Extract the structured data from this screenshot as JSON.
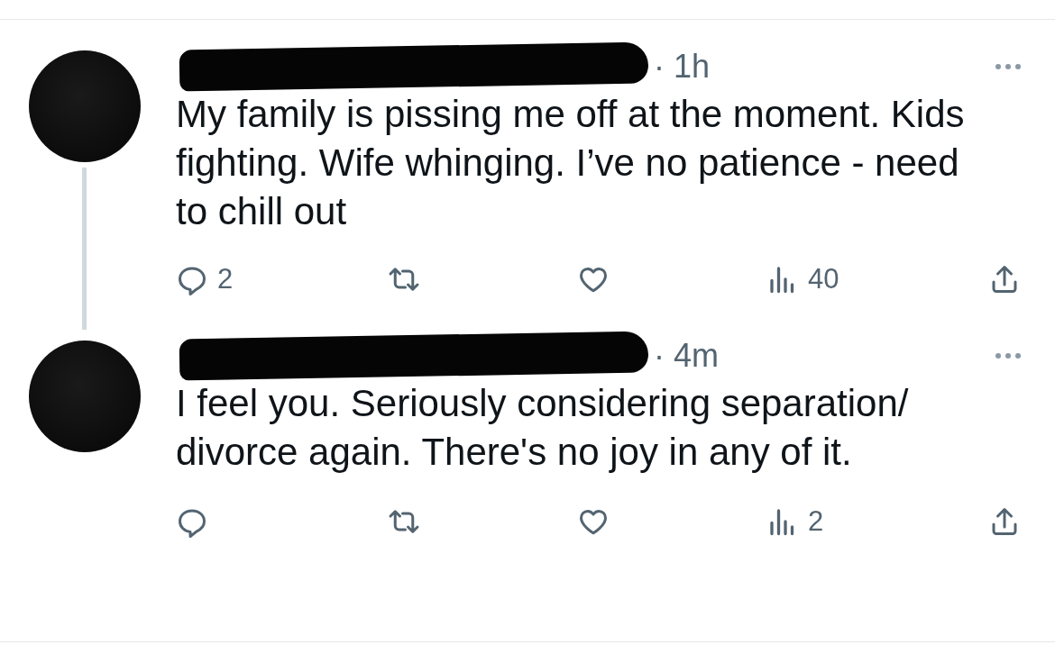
{
  "posts": [
    {
      "time": "· 1h",
      "text": "My family is pissing me off at the moment. Kids fighting. Wife whinging. I’ve no patience - need to chill out",
      "thread_line": true,
      "replies": "2",
      "views": "40"
    },
    {
      "time": "· 4m",
      "text": "I feel you. Seriously considering separation/ divorce again. There's no joy in any of it.",
      "thread_line": false,
      "views": "2"
    }
  ]
}
